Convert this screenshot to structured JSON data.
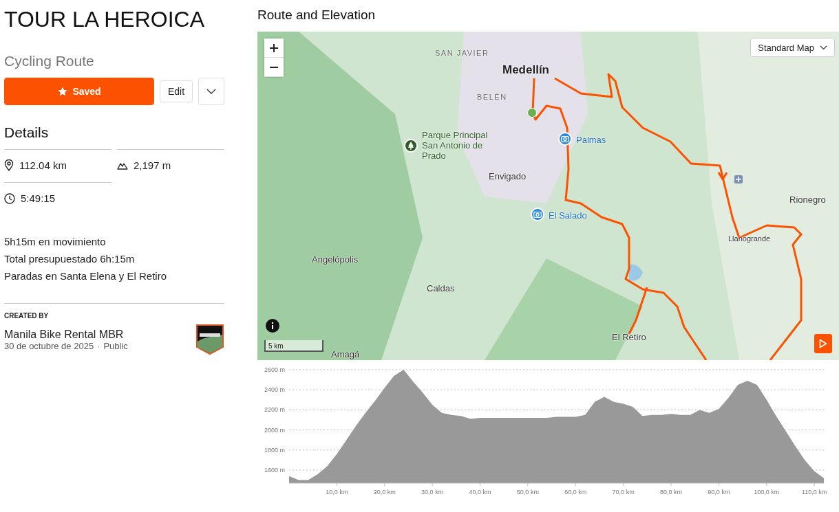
{
  "title": "TOUR LA HEROICA",
  "subtitle": "Cycling Route",
  "actions": {
    "save": {
      "label": "Saved",
      "selected": true
    },
    "edit": "Edit"
  },
  "details": {
    "heading": "Details",
    "distance": "112.04 km",
    "elevation": "2,197 m",
    "time": "5:49:15"
  },
  "notes": [
    "5h15m en movimiento",
    "Total presupuestado 6h:15m",
    "Paradas en Santa Elena y El Retiro"
  ],
  "creator": {
    "label": "CREATED BY",
    "name": "Manila Bike Rental MBR",
    "date": "30 de octubre de 2025",
    "separator": "·",
    "visibility": "Public"
  },
  "section_title": "Route and Elevation",
  "map": {
    "style_select": "Standard Map",
    "scale": "5 km",
    "labels": [
      {
        "text": "SAN JAVIER",
        "kind": "district"
      },
      {
        "text": "Medellín",
        "kind": "city"
      },
      {
        "text": "BELÉN",
        "kind": "district"
      },
      {
        "text": "Parque Principal San Antonio de Prado",
        "kind": "park"
      },
      {
        "text": "Palmas",
        "kind": "photo"
      },
      {
        "text": "Envigado",
        "kind": "town"
      },
      {
        "text": "Rionegro",
        "kind": "town"
      },
      {
        "text": "El Salado",
        "kind": "photo"
      },
      {
        "text": "Llanogrande",
        "kind": "small"
      },
      {
        "text": "Angelópolis",
        "kind": "town"
      },
      {
        "text": "Caldas",
        "kind": "town"
      },
      {
        "text": "El Retiro",
        "kind": "town"
      },
      {
        "text": "Amagá",
        "kind": "town"
      }
    ]
  },
  "elevation": {
    "chart_data": {
      "type": "area",
      "grid": true,
      "ylim": [
        1470,
        2600
      ],
      "xlim": [
        0,
        112
      ],
      "yticks": [
        {
          "value": 1600,
          "label": "1600 m"
        },
        {
          "value": 1800,
          "label": "1800 m"
        },
        {
          "value": 2000,
          "label": "2000 m"
        },
        {
          "value": 2200,
          "label": "2200 m"
        },
        {
          "value": 2400,
          "label": "2400 m"
        },
        {
          "value": 2600,
          "label": "2600 m"
        }
      ],
      "xticks": [
        {
          "value": 10,
          "label": "10,0 km"
        },
        {
          "value": 20,
          "label": "20,0 km"
        },
        {
          "value": 30,
          "label": "30,0 km"
        },
        {
          "value": 40,
          "label": "40,0 km"
        },
        {
          "value": 50,
          "label": "50,0 km"
        },
        {
          "value": 60,
          "label": "60,0 km"
        },
        {
          "value": 70,
          "label": "70,0 km"
        },
        {
          "value": 80,
          "label": "80,0 km"
        },
        {
          "value": 90,
          "label": "90,0 km"
        },
        {
          "value": 100,
          "label": "100,0 km"
        },
        {
          "value": 110,
          "label": "110,0 km"
        }
      ],
      "x": [
        0,
        2,
        4,
        6,
        8,
        10,
        12,
        14,
        16,
        18,
        20,
        22,
        24,
        26,
        28,
        30,
        32,
        34,
        36,
        38,
        40,
        42,
        44,
        46,
        48,
        50,
        52,
        54,
        56,
        58,
        60,
        62,
        64,
        66,
        68,
        70,
        72,
        74,
        76,
        78,
        80,
        82,
        84,
        86,
        88,
        90,
        92,
        94,
        96,
        98,
        100,
        102,
        104,
        106,
        108,
        110,
        112
      ],
      "series": [
        {
          "color": "#999999",
          "values": [
            1540,
            1500,
            1500,
            1560,
            1640,
            1760,
            1900,
            2040,
            2170,
            2290,
            2420,
            2540,
            2600,
            2480,
            2370,
            2250,
            2170,
            2150,
            2140,
            2110,
            2120,
            2120,
            2120,
            2120,
            2120,
            2120,
            2120,
            2120,
            2130,
            2130,
            2130,
            2150,
            2280,
            2330,
            2280,
            2260,
            2230,
            2140,
            2150,
            2150,
            2160,
            2150,
            2150,
            2200,
            2170,
            2210,
            2320,
            2450,
            2490,
            2450,
            2300,
            2140,
            1990,
            1840,
            1700,
            1590,
            1520
          ]
        }
      ]
    }
  }
}
